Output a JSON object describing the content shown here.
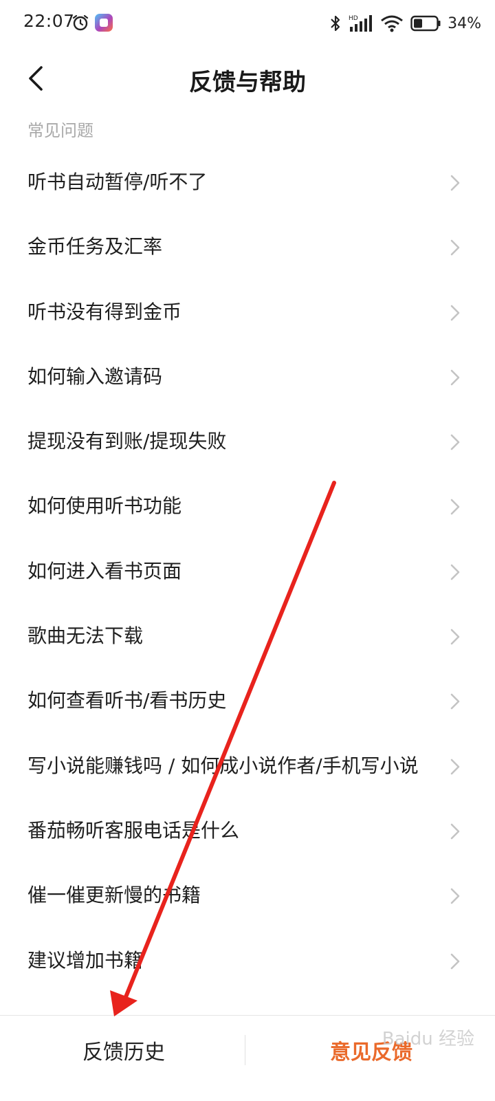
{
  "status_bar": {
    "time": "22:07",
    "battery_percent": "34%",
    "network_label": "HD",
    "icons": [
      "alarm-icon",
      "app-icon",
      "bluetooth-icon",
      "signal-icon",
      "wifi-icon",
      "battery-icon"
    ]
  },
  "header": {
    "title": "反馈与帮助",
    "back_icon": "back-arrow-icon"
  },
  "faq": {
    "section_title": "常见问题",
    "items": [
      {
        "label": "听书自动暂停/听不了"
      },
      {
        "label": "金币任务及汇率"
      },
      {
        "label": "听书没有得到金币"
      },
      {
        "label": "如何输入邀请码"
      },
      {
        "label": "提现没有到账/提现失败"
      },
      {
        "label": "如何使用听书功能"
      },
      {
        "label": "如何进入看书页面"
      },
      {
        "label": "歌曲无法下载"
      },
      {
        "label": "如何查看听书/看书历史"
      },
      {
        "label": "写小说能赚钱吗 / 如何成小说作者/手机写小说"
      },
      {
        "label": "番茄畅听客服电话是什么"
      },
      {
        "label": "催一催更新慢的书籍"
      },
      {
        "label": "建议增加书籍"
      }
    ]
  },
  "bottom_bar": {
    "history_label": "反馈历史",
    "feedback_label": "意见反馈"
  },
  "watermark": "Baidu 经验",
  "colors": {
    "accent": "#ea6a2b",
    "section_text": "#a9a9a9",
    "annotation_arrow": "#e8231d"
  }
}
